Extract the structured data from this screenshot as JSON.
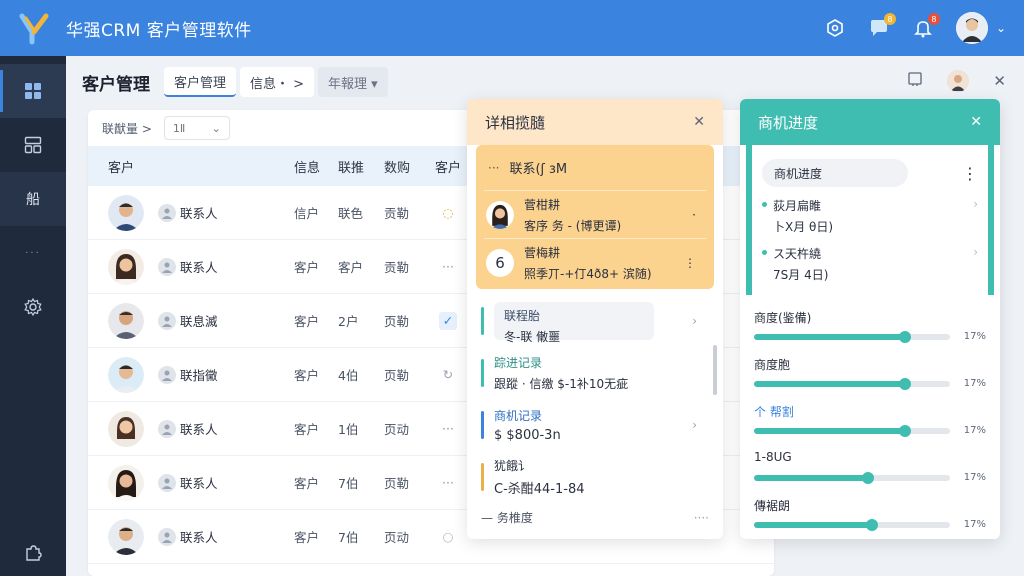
{
  "app": {
    "title": "华强CRM   客户管理软件"
  },
  "topbar": {
    "notif_badge": "8",
    "msg_badge": "8"
  },
  "sidebar": {
    "items": [
      "dashboard",
      "modules",
      "customers",
      "more",
      "settings"
    ]
  },
  "page": {
    "title": "客户管理",
    "tabs": [
      {
        "label": "客户管理"
      },
      {
        "label": "信息・ >"
      },
      {
        "label": "年報理 ▾"
      }
    ]
  },
  "filter": {
    "label": "联猷量 >",
    "select_value": "1Ⅱ"
  },
  "table": {
    "columns": [
      "客户",
      "信息",
      "联推",
      "数购",
      "客户"
    ],
    "rows": [
      {
        "contact": "联系人",
        "a": "信户",
        "b": "联色",
        "c": "贡勒",
        "status": "ring"
      },
      {
        "contact": "联系人",
        "a": "客户",
        "b": "客户",
        "c": "贡勒",
        "status": "dots"
      },
      {
        "contact": "联息滅",
        "a": "客户",
        "b": "2户",
        "c": "页勒",
        "status": "check"
      },
      {
        "contact": "联指黴",
        "a": "客户",
        "b": "4伯",
        "c": "页勒",
        "status": "refresh"
      },
      {
        "contact": "联系人",
        "a": "客户",
        "b": "1伯",
        "c": "页动",
        "status": "dots"
      },
      {
        "contact": "联系人",
        "a": "客户",
        "b": "7伯",
        "c": "页勒",
        "status": "dots"
      },
      {
        "contact": "联系人",
        "a": "客户",
        "b": "7伯",
        "c": "页动",
        "status": "circle"
      }
    ]
  },
  "detail": {
    "title": "详相揽膸",
    "top_row": "联系(ʃ ɜM",
    "person1_name": "菅柑耕",
    "person1_sub": "客序 务 - (博更谭)",
    "person2_num": "6",
    "person2_name": "菅梅耕",
    "person2_sub": "照季丌-+仃4ð8+ 滨随)",
    "items": [
      {
        "title": "联程胎",
        "sub": "冬-联 僌噩",
        "color": "#3fbdb1"
      },
      {
        "title": "踪进记录",
        "sub": "跟蹤 · 信缴 $-1补10无疵",
        "color": "#3fbdb1"
      },
      {
        "title": "商机记录",
        "sub": "$ $800-3n",
        "color": "#3a84e0"
      },
      {
        "title": "犹餓讠",
        "sub": "C-杀酣44-1-84",
        "color": "#e8b04a"
      }
    ],
    "footer": "— 务椎度"
  },
  "opportunity": {
    "title": "商机进度",
    "pill": "商机进度",
    "dates": [
      {
        "line1": "荻月扁睢",
        "line2": "卜X月 θ日)"
      },
      {
        "line1": "ス天杵繞",
        "line2": "7S月 4日)"
      }
    ],
    "progress": [
      {
        "label": "商度(鉴備)",
        "value": 0.77,
        "pct": "17%"
      },
      {
        "label": "商度胞",
        "value": 0.77,
        "pct": "17%"
      },
      {
        "label": "个 帮割",
        "value": 0.77,
        "pct": "17%"
      },
      {
        "label": "1-8UG",
        "value": 0.58,
        "pct": "17%"
      },
      {
        "label": "傳裾朗",
        "value": 0.6,
        "pct": "17%"
      }
    ]
  },
  "colors": {
    "primary": "#3a84e0",
    "teal": "#3fbdb1",
    "orange": "#fbd38f",
    "sidebar": "#1f2a3c"
  }
}
